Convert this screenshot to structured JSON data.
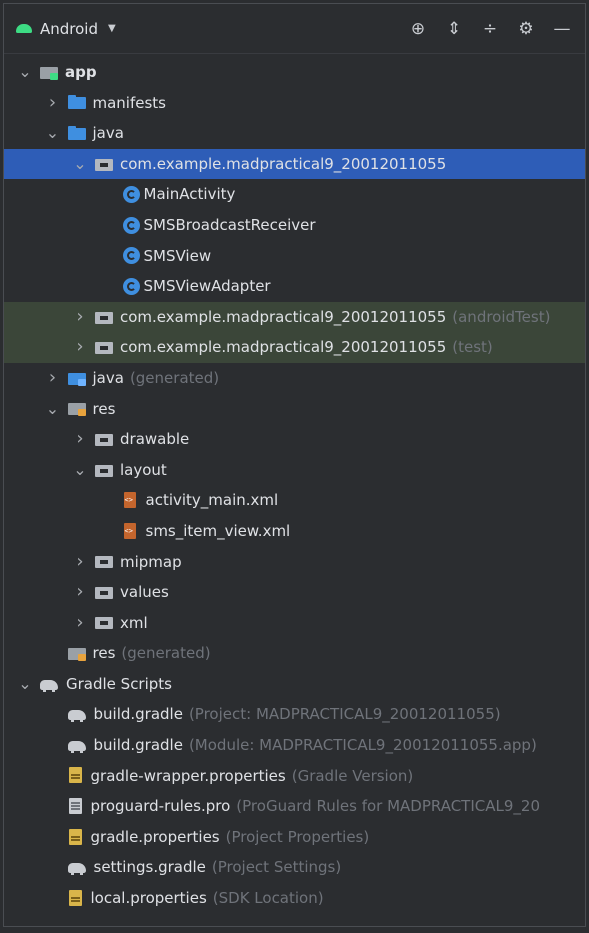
{
  "toolbar": {
    "view_label": "Android",
    "icons": [
      "target-icon",
      "expand-all-icon",
      "collapse-all-icon",
      "gear-icon",
      "minimize-icon"
    ]
  },
  "tree": [
    {
      "indent": 0,
      "chevron": "down",
      "icon": "module",
      "label": "app",
      "hint": "",
      "bold": true
    },
    {
      "indent": 1,
      "chevron": "right",
      "icon": "folder-blue",
      "label": "manifests",
      "hint": ""
    },
    {
      "indent": 1,
      "chevron": "down",
      "icon": "folder-blue",
      "label": "java",
      "hint": ""
    },
    {
      "indent": 2,
      "chevron": "down",
      "icon": "package",
      "label": "com.example.madpractical9_20012011055",
      "hint": "",
      "state": "selected"
    },
    {
      "indent": 3,
      "chevron": "none",
      "icon": "class",
      "label": "MainActivity",
      "hint": ""
    },
    {
      "indent": 3,
      "chevron": "none",
      "icon": "class",
      "label": "SMSBroadcastReceiver",
      "hint": ""
    },
    {
      "indent": 3,
      "chevron": "none",
      "icon": "class",
      "label": "SMSView",
      "hint": ""
    },
    {
      "indent": 3,
      "chevron": "none",
      "icon": "class",
      "label": "SMSViewAdapter",
      "hint": ""
    },
    {
      "indent": 2,
      "chevron": "right",
      "icon": "package",
      "label": "com.example.madpractical9_20012011055",
      "hint": "(androidTest)",
      "state": "test"
    },
    {
      "indent": 2,
      "chevron": "right",
      "icon": "package",
      "label": "com.example.madpractical9_20012011055",
      "hint": "(test)",
      "state": "test"
    },
    {
      "indent": 1,
      "chevron": "right",
      "icon": "gen",
      "label": "java",
      "hint": "(generated)"
    },
    {
      "indent": 1,
      "chevron": "down",
      "icon": "res",
      "label": "res",
      "hint": ""
    },
    {
      "indent": 2,
      "chevron": "right",
      "icon": "package",
      "label": "drawable",
      "hint": ""
    },
    {
      "indent": 2,
      "chevron": "down",
      "icon": "package",
      "label": "layout",
      "hint": ""
    },
    {
      "indent": 3,
      "chevron": "none",
      "icon": "xml",
      "label": "activity_main.xml",
      "hint": ""
    },
    {
      "indent": 3,
      "chevron": "none",
      "icon": "xml",
      "label": "sms_item_view.xml",
      "hint": ""
    },
    {
      "indent": 2,
      "chevron": "right",
      "icon": "package",
      "label": "mipmap",
      "hint": ""
    },
    {
      "indent": 2,
      "chevron": "right",
      "icon": "package",
      "label": "values",
      "hint": ""
    },
    {
      "indent": 2,
      "chevron": "right",
      "icon": "package",
      "label": "xml",
      "hint": ""
    },
    {
      "indent": 1,
      "chevron": "none",
      "icon": "res",
      "label": "res",
      "hint": "(generated)"
    },
    {
      "indent": 0,
      "chevron": "down",
      "icon": "gradle",
      "label": "Gradle Scripts",
      "hint": ""
    },
    {
      "indent": 1,
      "chevron": "none",
      "icon": "gradle",
      "label": "build.gradle",
      "hint": "(Project: MADPRACTICAL9_20012011055)"
    },
    {
      "indent": 1,
      "chevron": "none",
      "icon": "gradle",
      "label": "build.gradle",
      "hint": "(Module: MADPRACTICAL9_20012011055.app)"
    },
    {
      "indent": 1,
      "chevron": "none",
      "icon": "props",
      "label": "gradle-wrapper.properties",
      "hint": "(Gradle Version)"
    },
    {
      "indent": 1,
      "chevron": "none",
      "icon": "text",
      "label": "proguard-rules.pro",
      "hint": "(ProGuard Rules for MADPRACTICAL9_20"
    },
    {
      "indent": 1,
      "chevron": "none",
      "icon": "props",
      "label": "gradle.properties",
      "hint": "(Project Properties)"
    },
    {
      "indent": 1,
      "chevron": "none",
      "icon": "gradle",
      "label": "settings.gradle",
      "hint": "(Project Settings)"
    },
    {
      "indent": 1,
      "chevron": "none",
      "icon": "props",
      "label": "local.properties",
      "hint": "(SDK Location)"
    }
  ]
}
